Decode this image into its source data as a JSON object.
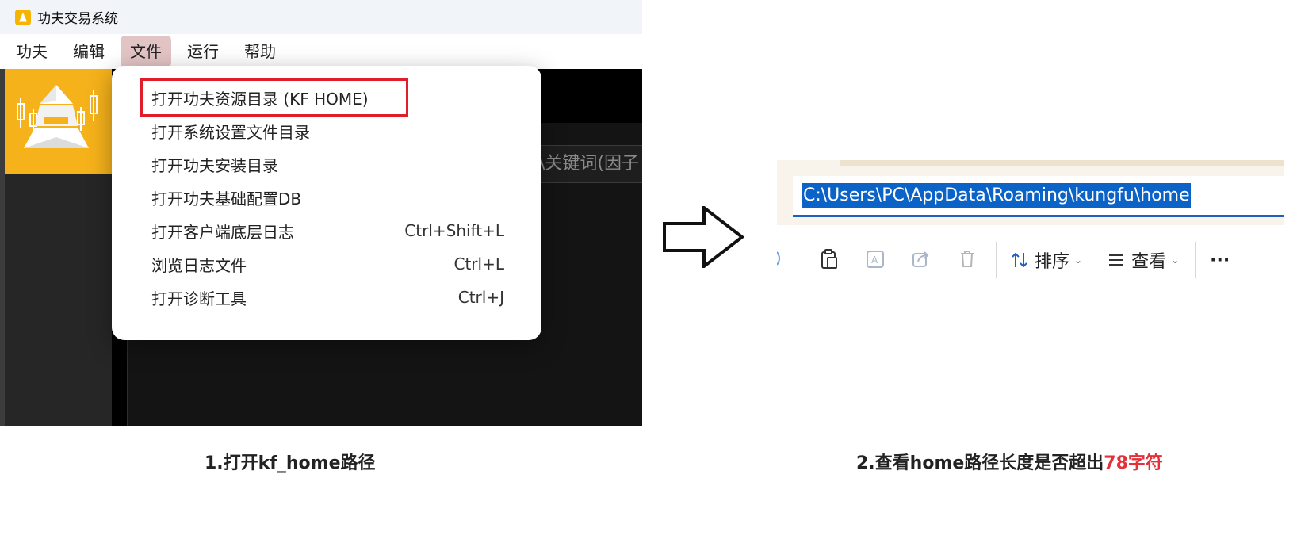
{
  "app": {
    "title": "功夫交易系统",
    "menus": [
      {
        "label": "功夫"
      },
      {
        "label": "编辑"
      },
      {
        "label": "文件"
      },
      {
        "label": "运行"
      },
      {
        "label": "帮助"
      }
    ],
    "search_placeholder": "\\关键词(因子",
    "file_menu": [
      {
        "label": "打开功夫资源目录 (KF  HOME)",
        "shortcut": ""
      },
      {
        "label": "打开系统设置文件目录",
        "shortcut": ""
      },
      {
        "label": "打开功夫安装目录",
        "shortcut": ""
      },
      {
        "label": "打开功夫基础配置DB",
        "shortcut": ""
      },
      {
        "label": "打开客户端底层日志",
        "shortcut": "Ctrl+Shift+L"
      },
      {
        "label": "浏览日志文件",
        "shortcut": "Ctrl+L"
      },
      {
        "label": "打开诊断工具",
        "shortcut": "Ctrl+J"
      }
    ]
  },
  "explorer": {
    "address_path": "C:\\Users\\PC\\AppData\\Roaming\\kungfu\\home",
    "sort_label": "排序",
    "view_label": "查看",
    "more_label": "···"
  },
  "captions": {
    "step1": "1.打开kf_home路径",
    "step2_prefix": "2.查看home路径长度是否超出",
    "step2_accent": "78字符"
  },
  "colors": {
    "accent_red": "#e5303a",
    "highlight_red": "#e11d2a",
    "brand_yellow": "#f6b21b",
    "selection_blue": "#0b63c8"
  }
}
